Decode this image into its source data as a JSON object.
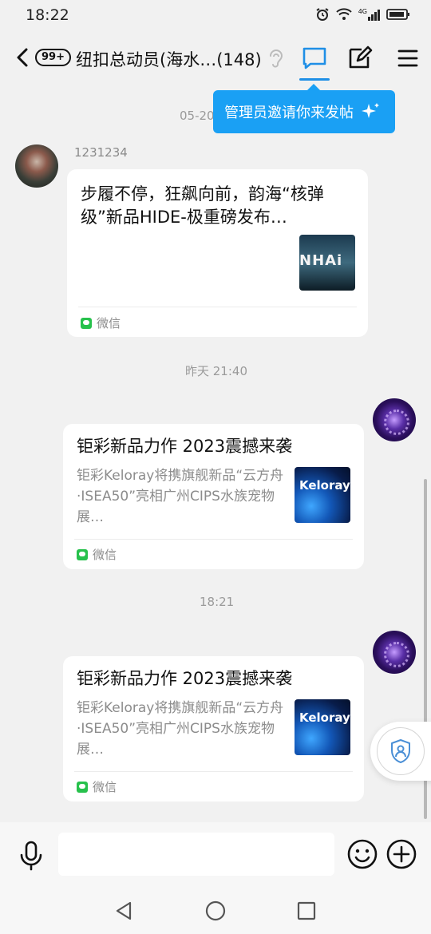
{
  "status": {
    "time": "18:22",
    "signal_label": "4G"
  },
  "header": {
    "back_label": "back",
    "unread_badge": "99+",
    "title": "纽扣总动员(海水…(148)",
    "icons": {
      "ear": "ear-icon",
      "chat": "chat-bubble-icon",
      "edit": "edit-icon",
      "menu": "menu-icon"
    }
  },
  "tooltip": {
    "text": "管理员邀请你来发帖"
  },
  "messages": [
    {
      "timestamp": "05-20",
      "sender": "1231234",
      "title": "步履不停，狂飙向前，韵海“核弹级”新品HIDE-极重磅发布…",
      "thumb_text": "NHAi",
      "source": "微信"
    },
    {
      "timestamp": "昨天 21:40",
      "title": "钜彩新品力作 2023震撼来袭",
      "desc": "钜彩Keloray将携旗舰新品“云方舟·ISEA50”亮相广州CIPS水族宠物展…",
      "thumb_text": "Keloray",
      "source": "微信"
    },
    {
      "timestamp": "18:21",
      "title": "钜彩新品力作 2023震撼来袭",
      "desc": "钜彩Keloray将携旗舰新品“云方舟·ISEA50”亮相广州CIPS水族宠物展…",
      "thumb_text": "Keloray",
      "source": "微信"
    }
  ],
  "input": {
    "placeholder": ""
  },
  "colors": {
    "accent": "#1aa0f4",
    "wechat": "#27c14c",
    "background": "#f1f1f1"
  }
}
